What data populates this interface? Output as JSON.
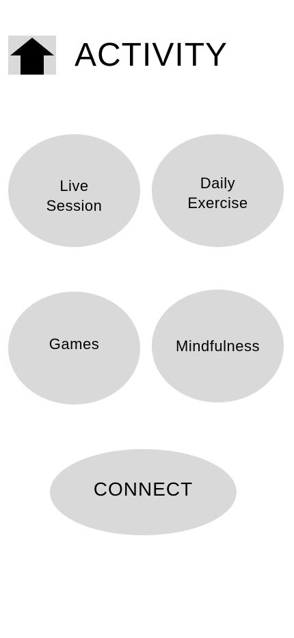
{
  "header": {
    "home_icon": "up-arrow-home-icon",
    "title": "ACTIVITY"
  },
  "activities": {
    "live_session": "Live\nSession",
    "daily_exercise": "Daily\nExercise",
    "games": "Games",
    "mindfulness": "Mindfulness"
  },
  "connect": {
    "label": "CONNECT"
  },
  "colors": {
    "button_fill": "#d9d9d9",
    "text": "#000000",
    "background": "#ffffff"
  }
}
